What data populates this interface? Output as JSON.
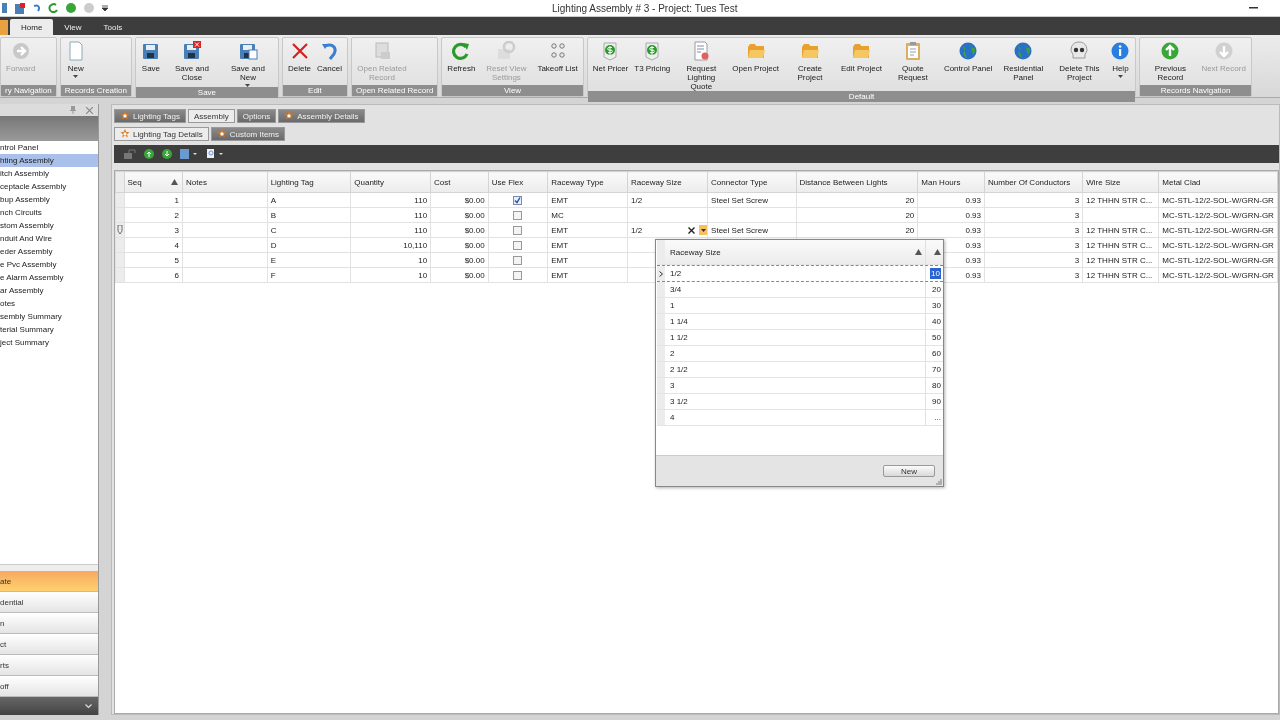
{
  "window": {
    "title": "Lighting Assembly # 3 -  Project: Tues Test"
  },
  "ribbon_tabs": [
    {
      "label": "Home",
      "selected": true
    },
    {
      "label": "View",
      "selected": false
    },
    {
      "label": "Tools",
      "selected": false
    }
  ],
  "ribbon_groups": [
    {
      "label": "ry Navigation",
      "buttons": [
        {
          "label": "Forward",
          "disabled": true,
          "menu": false
        }
      ]
    },
    {
      "label": "Records Creation",
      "buttons": [
        {
          "label": "New",
          "disabled": false,
          "menu": true
        }
      ]
    },
    {
      "label": "Save",
      "buttons": [
        {
          "label": "Save",
          "disabled": false,
          "menu": false
        },
        {
          "label": "Save and Close",
          "disabled": false,
          "menu": false
        },
        {
          "label": "Save and New",
          "disabled": false,
          "menu": true
        }
      ]
    },
    {
      "label": "Edit",
      "buttons": [
        {
          "label": "Delete",
          "disabled": false,
          "menu": false
        },
        {
          "label": "Cancel",
          "disabled": false,
          "menu": false
        }
      ]
    },
    {
      "label": "Open Related Record",
      "buttons": [
        {
          "label": "Open Related Record",
          "disabled": true,
          "menu": false
        }
      ]
    },
    {
      "label": "View",
      "buttons": [
        {
          "label": "Refresh",
          "disabled": false,
          "menu": false
        },
        {
          "label": "Reset View Settings",
          "disabled": true,
          "menu": false
        },
        {
          "label": "Takeoff List",
          "disabled": false,
          "menu": false
        }
      ]
    },
    {
      "label": "Default",
      "buttons": [
        {
          "label": "Net Pricer",
          "disabled": false,
          "menu": false
        },
        {
          "label": "T3 Pricing",
          "disabled": false,
          "menu": false
        },
        {
          "label": "Request Lighting Quote",
          "disabled": false,
          "menu": false
        },
        {
          "label": "Open Project",
          "disabled": false,
          "menu": false
        },
        {
          "label": "Create Project",
          "disabled": false,
          "menu": false
        },
        {
          "label": "Edit Project",
          "disabled": false,
          "menu": false
        },
        {
          "label": "Quote Request",
          "disabled": false,
          "menu": false
        },
        {
          "label": "Control Panel",
          "disabled": false,
          "menu": false
        },
        {
          "label": "Residential Panel",
          "disabled": false,
          "menu": false
        },
        {
          "label": "Delete This Project",
          "disabled": false,
          "menu": false
        },
        {
          "label": "Help",
          "disabled": false,
          "menu": true
        }
      ]
    },
    {
      "label": "Records Navigation",
      "buttons": [
        {
          "label": "Previous Record",
          "disabled": false,
          "menu": false
        },
        {
          "label": "Next Record",
          "disabled": true,
          "menu": false
        }
      ]
    }
  ],
  "navigator": {
    "items": [
      {
        "label": "ntrol Panel",
        "selected": false
      },
      {
        "label": "hting Assembly",
        "selected": true
      },
      {
        "label": "itch Assembly",
        "selected": false
      },
      {
        "label": "ceptacle Assembly",
        "selected": false
      },
      {
        "label": "bup Assembly",
        "selected": false
      },
      {
        "label": "nch Circuits",
        "selected": false
      },
      {
        "label": "stom Assembly",
        "selected": false
      },
      {
        "label": "nduit And Wire",
        "selected": false
      },
      {
        "label": "eder Assembly",
        "selected": false
      },
      {
        "label": "e Pvc Assembly",
        "selected": false
      },
      {
        "label": "e Alarm Assembly",
        "selected": false
      },
      {
        "label": "ar Assembly",
        "selected": false
      },
      {
        "label": "otes",
        "selected": false
      },
      {
        "label": "sembly Summary",
        "selected": false
      },
      {
        "label": "terial Summary",
        "selected": false
      },
      {
        "label": "ject Summary",
        "selected": false
      }
    ],
    "buttons": [
      {
        "label": "ate",
        "selected": true
      },
      {
        "label": "dential",
        "selected": false
      },
      {
        "label": "n",
        "selected": false
      },
      {
        "label": "ct",
        "selected": false
      },
      {
        "label": "rts",
        "selected": false
      },
      {
        "label": "off",
        "selected": false
      }
    ]
  },
  "tabs": [
    {
      "label": "Lighting Tags",
      "icon": true,
      "selected": false
    },
    {
      "label": "Assembly",
      "icon": false,
      "selected": true
    },
    {
      "label": "Options",
      "icon": false,
      "selected": false
    },
    {
      "label": "Assembly Details",
      "icon": true,
      "selected": false
    }
  ],
  "subtabs": [
    {
      "label": "Lighting Tag Details",
      "icon": true,
      "selected": true
    },
    {
      "label": "Custom Items",
      "icon": true,
      "selected": false
    }
  ],
  "grid": {
    "columns": [
      {
        "label": "Seq",
        "kind": "number",
        "sorted": true
      },
      {
        "label": "Notes",
        "kind": "text",
        "sorted": false
      },
      {
        "label": "Lighting Tag",
        "kind": "text",
        "sorted": false
      },
      {
        "label": "Quantity",
        "kind": "number",
        "sorted": false
      },
      {
        "label": "Cost",
        "kind": "number",
        "sorted": false
      },
      {
        "label": "Use Flex",
        "kind": "check",
        "sorted": false
      },
      {
        "label": "Raceway Type",
        "kind": "text",
        "sorted": false
      },
      {
        "label": "Raceway Size",
        "kind": "text",
        "sorted": false
      },
      {
        "label": "Connector Type",
        "kind": "text",
        "sorted": false
      },
      {
        "label": "Distance Between Lights",
        "kind": "number",
        "sorted": false
      },
      {
        "label": "Man Hours",
        "kind": "number",
        "sorted": false
      },
      {
        "label": "Number Of Conductors",
        "kind": "number",
        "sorted": false
      },
      {
        "label": "Wire Size",
        "kind": "text",
        "sorted": false
      },
      {
        "label": "Metal Clad",
        "kind": "text",
        "sorted": false
      }
    ],
    "rows": [
      {
        "editing": false,
        "cells": [
          "1",
          null,
          "A",
          "110",
          "$0.00",
          true,
          "EMT",
          "1/2",
          "Steel Set Screw",
          "20",
          "0.93",
          "3",
          "12 THHN STR C...",
          "MC-STL-12/2-SOL-W/GRN-GR"
        ]
      },
      {
        "editing": false,
        "cells": [
          "2",
          null,
          "B",
          "110",
          "$0.00",
          false,
          "MC",
          null,
          null,
          "20",
          "0.93",
          "3",
          null,
          "MC-STL-12/2-SOL-W/GRN-GR"
        ]
      },
      {
        "editing": true,
        "cells": [
          "3",
          null,
          "C",
          "110",
          "$0.00",
          false,
          "EMT",
          "1/2",
          "Steel Set Screw",
          "20",
          "0.93",
          "3",
          "12 THHN STR C...",
          "MC-STL-12/2-SOL-W/GRN-GR"
        ]
      },
      {
        "editing": false,
        "cells": [
          "4",
          null,
          "D",
          "10,110",
          "$0.00",
          false,
          "EMT",
          null,
          null,
          null,
          "0.93",
          "3",
          "12 THHN STR C...",
          "MC-STL-12/2-SOL-W/GRN-GR"
        ]
      },
      {
        "editing": false,
        "cells": [
          "5",
          null,
          "E",
          "10",
          "$0.00",
          false,
          "EMT",
          null,
          null,
          null,
          "0.93",
          "3",
          "12 THHN STR C...",
          "MC-STL-12/2-SOL-W/GRN-GR"
        ]
      },
      {
        "editing": false,
        "cells": [
          "6",
          null,
          "F",
          "10",
          "$0.00",
          false,
          "EMT",
          null,
          null,
          null,
          "0.93",
          "3",
          "12 THHN STR C...",
          "MC-STL-12/2-SOL-W/GRN-GR"
        ]
      }
    ]
  },
  "dropdown": {
    "column": "Raceway Size",
    "rows": [
      {
        "value": "1/2",
        "code": "10",
        "selected": true
      },
      {
        "value": "3/4",
        "code": "20",
        "selected": false
      },
      {
        "value": "1",
        "code": "30",
        "selected": false
      },
      {
        "value": "1 1/4",
        "code": "40",
        "selected": false
      },
      {
        "value": "1 1/2",
        "code": "50",
        "selected": false
      },
      {
        "value": "2",
        "code": "60",
        "selected": false
      },
      {
        "value": "2 1/2",
        "code": "70",
        "selected": false
      },
      {
        "value": "3",
        "code": "80",
        "selected": false
      },
      {
        "value": "3 1/2",
        "code": "90",
        "selected": false
      },
      {
        "value": "4",
        "code": "...",
        "selected": false
      }
    ],
    "button": "New"
  }
}
